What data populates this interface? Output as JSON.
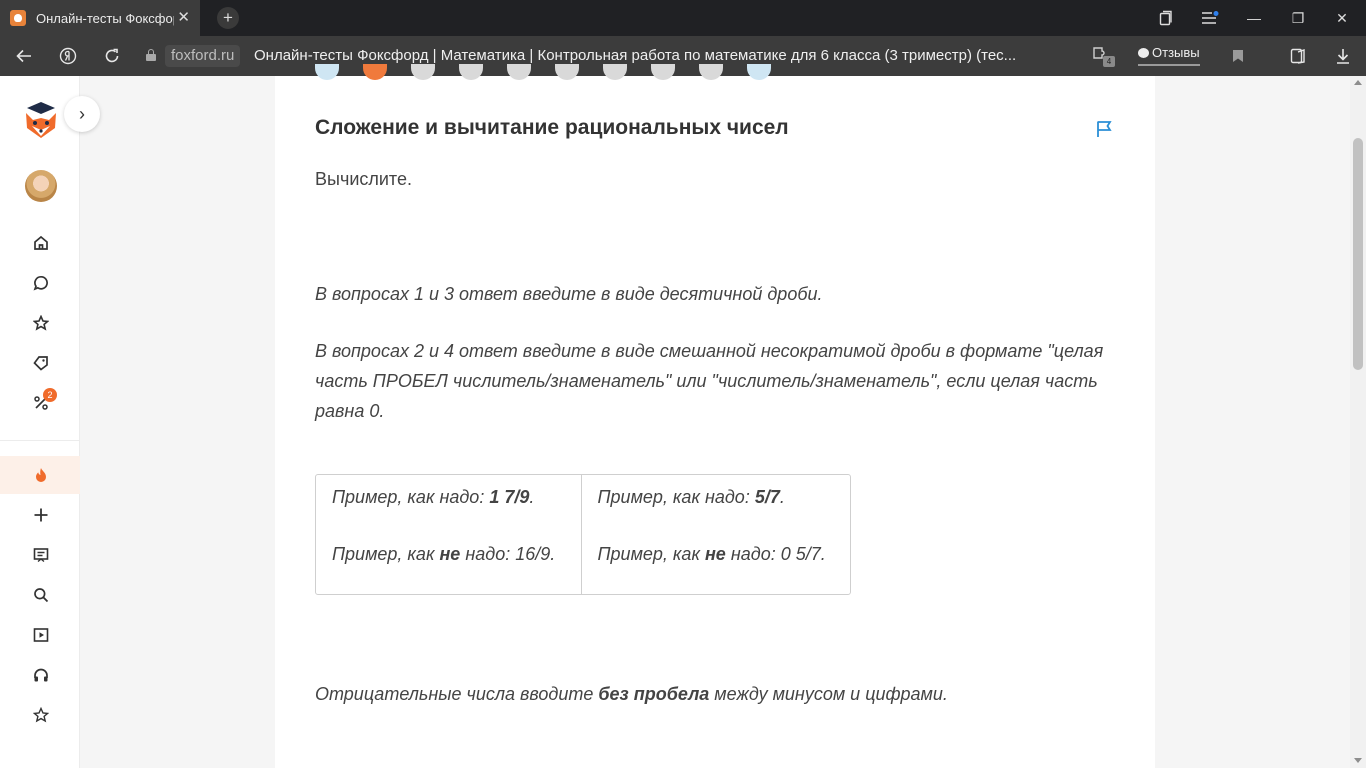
{
  "browser": {
    "tab_title": "Онлайн-тесты Фоксфорд | Математика",
    "tab_close": "✕",
    "new_tab": "+",
    "domain": "foxford.ru",
    "page_title": "Онлайн-тесты Фоксфорд | Математика | Контрольная работа по математике для 6 класса (3 триместр) (тес...",
    "reviews_label": "Отзывы",
    "extension_badge_count": "4",
    "window_controls": {
      "minimize": "—",
      "maximize": "❐",
      "close": "✕"
    }
  },
  "sidebar": {
    "expand_glyph": "›",
    "fire_color": "#f06b2b",
    "notification_count": "2",
    "icons": [
      "home-icon",
      "chat-icon",
      "star-icon",
      "tag-icon",
      "discount-icon",
      "fire-icon",
      "plus-icon",
      "presentation-icon",
      "search-icon",
      "play-icon",
      "headphones-icon",
      "star-outline-icon"
    ]
  },
  "content": {
    "section_title": "Сложение и вычитание рациональных чисел",
    "lead": "Вычислите.",
    "note_decimal": "В вопросах 1 и 3 ответ введите в виде десятичной дроби.",
    "note_mixed": "В вопросах 2 и 4 ответ введите в виде смешанной несократимой дроби в формате \"целая часть ПРОБЕЛ числитель/знаменатель\" или \"числитель/знаменатель\", если целая часть равна 0.",
    "examples": [
      {
        "good_prefix": "Пример, как надо: ",
        "good_value": "1 7/9",
        "good_suffix": ".",
        "bad_prefix": "Пример, как ",
        "bad_emphasis": "не",
        "bad_suffix": " надо: 16/9."
      },
      {
        "good_prefix": "Пример, как надо: ",
        "good_value": "5/7",
        "good_suffix": ".",
        "bad_prefix": "Пример, как ",
        "bad_emphasis": "не",
        "bad_suffix": " надо: 0 5/7."
      }
    ],
    "negative_prefix": "Отрицательные числа вводите ",
    "negative_emphasis": "без пробела",
    "negative_suffix": " между минусом и цифрами."
  },
  "colors": {
    "accent_orange": "#f06b2b",
    "flag_blue": "#2b8fd6"
  }
}
